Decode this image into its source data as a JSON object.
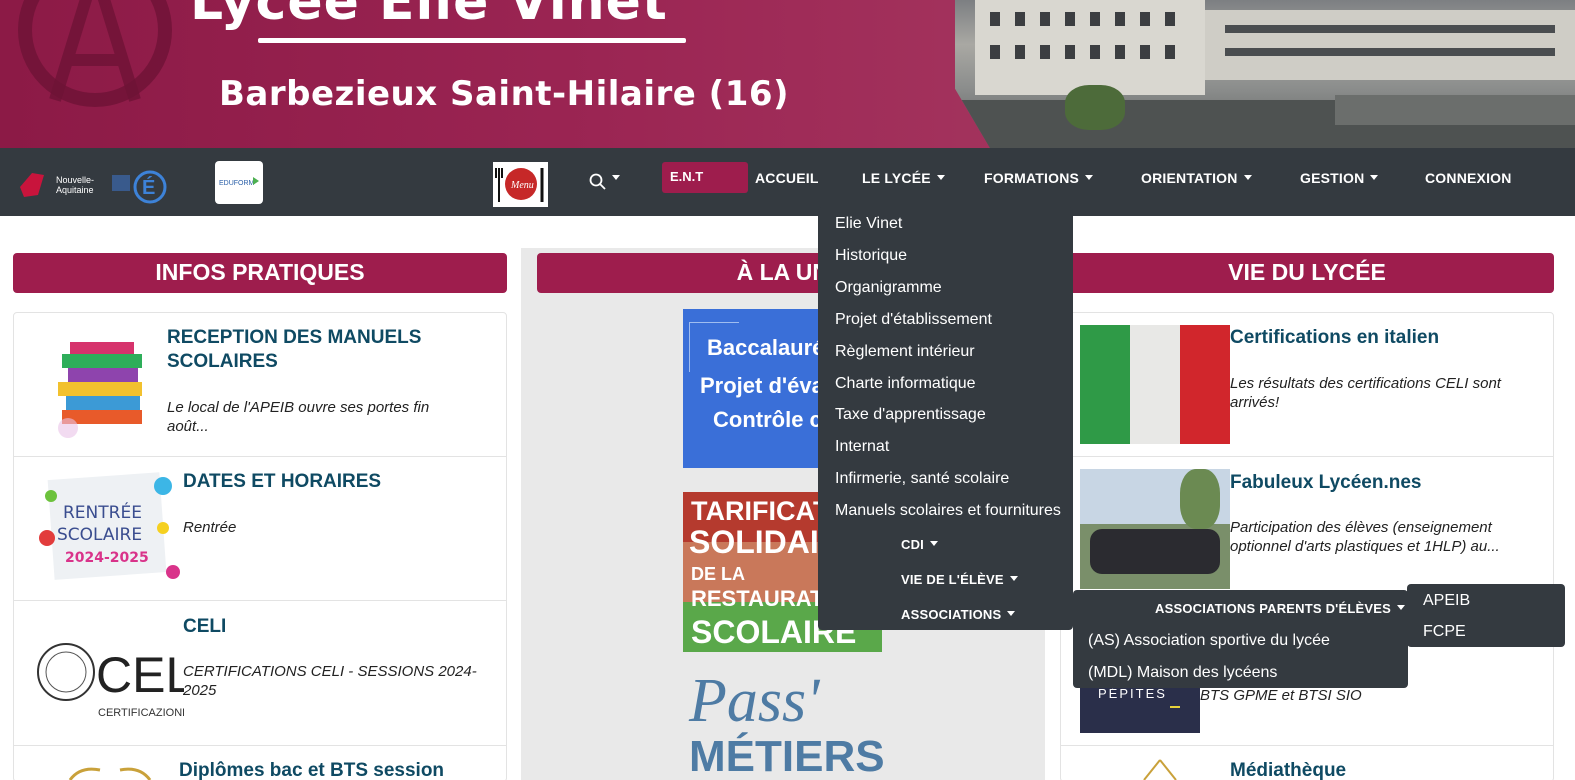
{
  "banner": {
    "title_top": "Lycée Elie Vinet",
    "subtitle": "Barbezieux Saint-Hilaire (16)"
  },
  "navbar": {
    "logo_region_line1": "Nouvelle-",
    "logo_region_line2": "Aquitaine",
    "logo_academie": "É",
    "logo_eduform": "EDUFORM",
    "logo_menu": "Menu",
    "ent_label": "E.N.T",
    "accueil": "ACCUEIL",
    "lycee": "LE LYCÉE",
    "formations": "FORMATIONS",
    "orientation": "ORIENTATION",
    "gestion": "GESTION",
    "connexion": "CONNEXION"
  },
  "sections": {
    "infos": "INFOS PRATIQUES",
    "une": "À LA UNE",
    "vie": "VIE DU LYCÉE"
  },
  "infos_cards": [
    {
      "title_l1": "RECEPTION DES MANUELS",
      "title_l2": "SCOLAIRES",
      "desc_l1": "Le local de l'APEIB ouvre ses portes fin",
      "desc_l2": "août..."
    },
    {
      "title_l1": "DATES ET HORAIRES",
      "desc_l1": "Rentrée",
      "thumb_l1": "RENTRÉE",
      "thumb_l2": "SCOLAIRE",
      "thumb_l3": "2024-2025"
    },
    {
      "title_l1": "CELI",
      "desc_l1": "CERTIFICATIONS CELI - SESSIONS 2024-",
      "desc_l2": "2025",
      "thumb_big": "CELI",
      "thumb_small": "CERTIFICAZIONE"
    },
    {
      "title_l1": "Diplômes bac et BTS session"
    }
  ],
  "une_cards": {
    "bac_l1": "Baccalauréat",
    "bac_l2": "Projet d'évaluation",
    "bac_l3": "Contrôle continu",
    "tarif_l1": "TARIFICATION",
    "tarif_l2": "SOLIDAIRE",
    "tarif_l3": "DE LA",
    "tarif_l4": "RESTAURATION",
    "tarif_l5": "SCOLAIRE",
    "pass_l1": "Pass'",
    "pass_l2": "MÉTIERS"
  },
  "vie_cards": [
    {
      "title_l1": "Certifications en italien",
      "desc_l1": "Les résultats des certifications CELI sont",
      "desc_l2": "arrivés!"
    },
    {
      "title_l1": "Fabuleux Lycéen.nes",
      "desc_l1": "Participation des élèves (enseignement",
      "desc_l2": "optionnel d'arts plastiques et 1HLP) au..."
    },
    {
      "desc_l1": "BTS GPME et BTSI SIO",
      "thumb_text": "PÉPITES"
    },
    {
      "title_l1": "Médiathèque"
    }
  ],
  "lycee_menu": {
    "items": [
      "Elie Vinet",
      "Historique",
      "Organigramme",
      "Projet d'établissement",
      "Règlement intérieur",
      "Charte informatique",
      "Taxe d'apprentissage",
      "Internat",
      "Infirmerie, santé scolaire",
      "Manuels scolaires et fournitures"
    ],
    "sub_cdi": "CDI",
    "sub_vie": "VIE DE L'ÉLÈVE",
    "sub_assoc": "ASSOCIATIONS"
  },
  "assoc_menu": {
    "parents": "ASSOCIATIONS PARENTS D'ÉLÈVES",
    "as": "(AS) Association sportive du lycée",
    "mdl": "(MDL) Maison des lycéens"
  },
  "parents_menu": {
    "apeib": "APEIB",
    "fcpe": "FCPE"
  },
  "colors": {
    "brand": "#9e1d4d",
    "navbar": "#343a40",
    "title_blue": "#0f4a63"
  }
}
